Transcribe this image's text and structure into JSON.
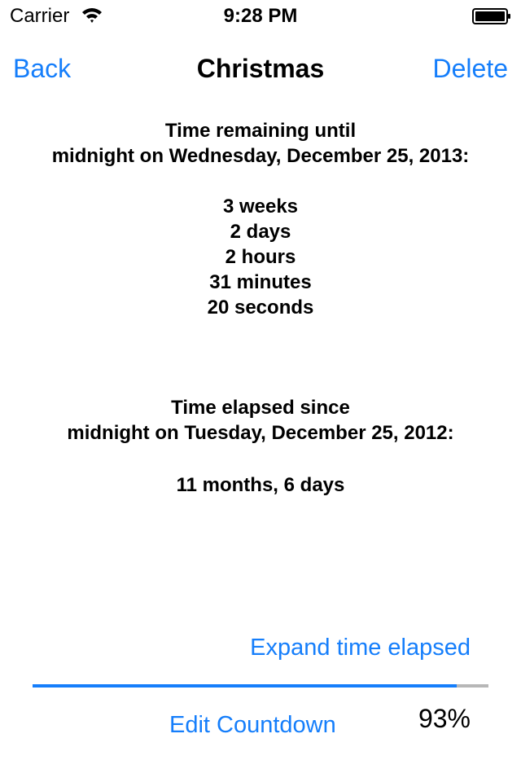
{
  "status_bar": {
    "carrier": "Carrier",
    "time": "9:28 PM",
    "wifi_icon": "wifi-icon",
    "battery_icon": "battery-icon"
  },
  "nav": {
    "back_label": "Back",
    "title": "Christmas",
    "delete_label": "Delete"
  },
  "remaining": {
    "line1": "Time remaining until",
    "line2": "midnight on Wednesday, December 25, 2013:",
    "values": [
      "3 weeks",
      "2 days",
      "2 hours",
      "31 minutes",
      "20 seconds"
    ]
  },
  "elapsed": {
    "line1": "Time elapsed since",
    "line2": "midnight on Tuesday, December 25, 2012:",
    "value": "11 months, 6 days"
  },
  "expand_link": "Expand time elapsed",
  "progress": {
    "fraction": 0.93,
    "percent_label": "93%",
    "fill_color": "#157efb",
    "track_color": "#b7b7b7"
  },
  "edit_link": "Edit Countdown",
  "colors": {
    "accent": "#157efb"
  }
}
